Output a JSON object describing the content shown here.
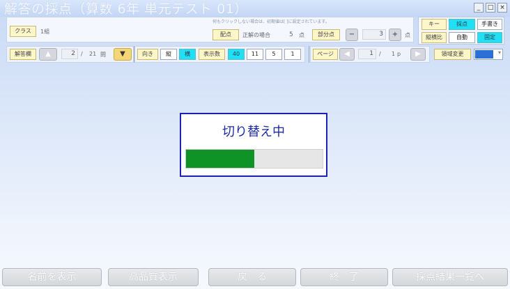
{
  "window": {
    "title": "解答の採点（算数 6年 単元テスト 01）",
    "controls": {
      "minimize": "_",
      "maximize": "□",
      "close": "×"
    }
  },
  "top": {
    "class_button": "クラス",
    "class_value": "1組",
    "notice": "何もクリックしない場合は、初期値は[ ]に設定されています。",
    "points_button": "配点",
    "correct_label": "正解の場合",
    "points_value": "5",
    "points_unit": "点",
    "partial_button": "部分点",
    "partial_minus": "−",
    "partial_value": "3",
    "partial_plus": "+",
    "partial_unit": "点"
  },
  "right_panel": {
    "key_button": "キー",
    "scoring_button": "採点",
    "manual_button": "手書き",
    "ratio_button": "縦横比",
    "auto_button": "自動",
    "fixed_button": "固定"
  },
  "nav": {
    "answer_column_button": "解答欄",
    "up_arrow": "▲",
    "current_question": "2",
    "question_separator": "/",
    "total_questions": "21",
    "question_unit": "問",
    "orientation_button": "向き",
    "vertical_button": "縦",
    "horizontal_button": "横",
    "display_count_button": "表示数",
    "count_options": [
      "40",
      "11",
      "5",
      "1"
    ],
    "page_button": "ページ",
    "page_prev": "◀",
    "current_page": "1",
    "page_separator": "/",
    "total_pages": "1",
    "page_unit": "p",
    "page_next": "▶",
    "region_change_button": "領域変更"
  },
  "dialog": {
    "title": "切り替え中",
    "progress": 0.5
  },
  "bottom": {
    "show_names": "名前を表示",
    "high_quality": "高品質表示",
    "back": "戻　る",
    "finish": "終　了",
    "results_list": "採点結果一覧へ"
  },
  "colors": {
    "accent_cyan": "#22e0f4",
    "button_yellow": "#fdf6c8",
    "progress_green": "#0f9326",
    "dialog_border": "#1c22b8"
  }
}
